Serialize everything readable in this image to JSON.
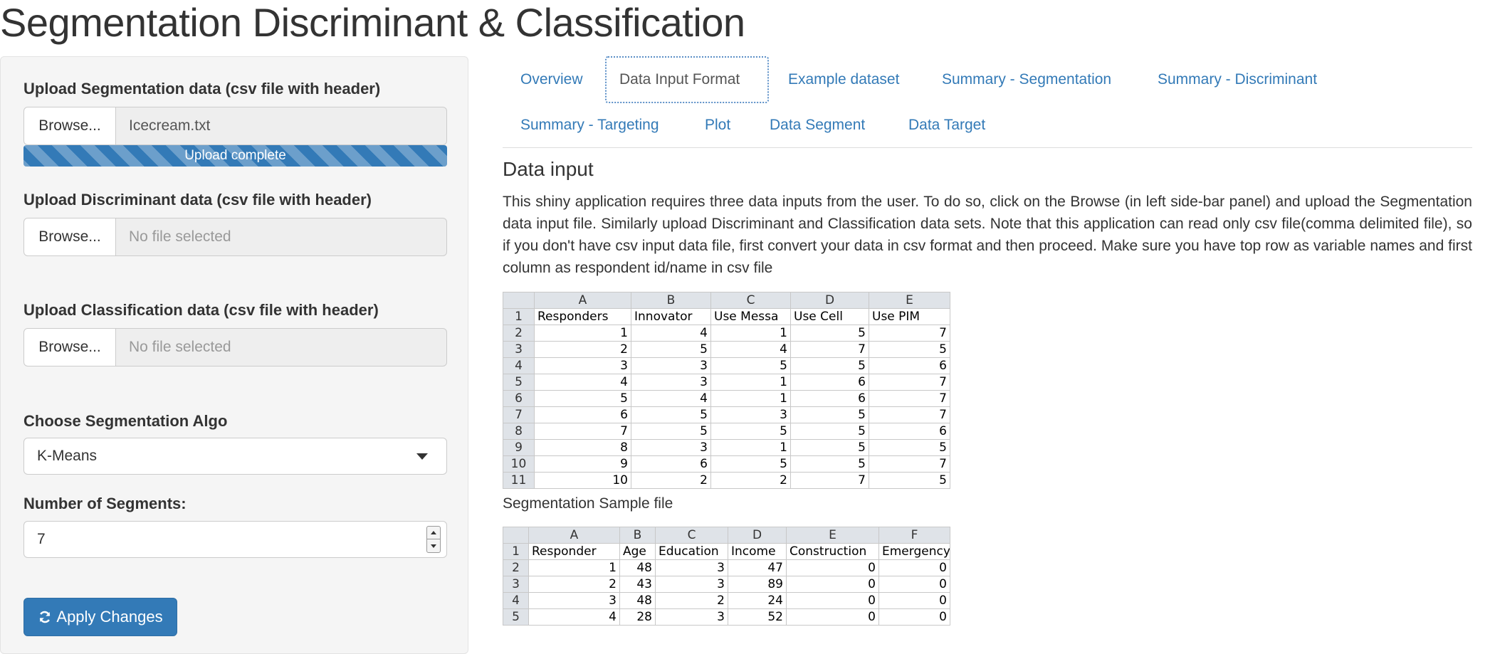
{
  "app": {
    "title": "Segmentation Discriminant & Classification"
  },
  "sidebar": {
    "segmentation_upload": {
      "label": "Upload Segmentation data (csv file with header)",
      "browse_label": "Browse...",
      "file_name": "Icecream.txt",
      "progress_text": "Upload complete",
      "progress": 1.0
    },
    "discriminant_upload": {
      "label": "Upload Discriminant data (csv file with header)",
      "browse_label": "Browse...",
      "file_name": "No file selected"
    },
    "classification_upload": {
      "label": "Upload Classification data (csv file with header)",
      "browse_label": "Browse...",
      "file_name": "No file selected"
    },
    "algo": {
      "label": "Choose Segmentation Algo",
      "selected": "K-Means"
    },
    "segments": {
      "label": "Number of Segments:",
      "value": "7"
    },
    "apply_label": "Apply Changes",
    "apply_icon": "refresh-icon"
  },
  "tabs": {
    "overview": "Overview",
    "data_input_format": "Data Input Format",
    "example_dataset": "Example dataset",
    "summary_segmentation": "Summary - Segmentation",
    "summary_discriminant": "Summary - Discriminant",
    "summary_targeting": "Summary - Targeting",
    "plot": "Plot",
    "data_segment": "Data Segment",
    "data_target": "Data Target",
    "active": "Data Input Format"
  },
  "main": {
    "heading": "Data input",
    "intro": "This shiny application requires three data inputs from the user. To do so, click on the Browse (in left side-bar panel) and upload the Segmentation data input file. Similarly upload Discriminant and Classification data sets. Note that this application can read only csv file(comma delimited file), so if you don't have csv input data file, first convert your data in csv format and then proceed. Make sure you have top row as variable names and first column as respondent id/name in csv file",
    "caption_segmentation": "Segmentation Sample file"
  },
  "sample_segmentation": {
    "col_letters": [
      "A",
      "B",
      "C",
      "D",
      "E"
    ],
    "headers": [
      "Responders",
      "Innovator",
      "Use Messa",
      "Use Cell",
      "Use PIM"
    ],
    "rows": [
      [
        1,
        4,
        1,
        5,
        7
      ],
      [
        2,
        5,
        4,
        7,
        5
      ],
      [
        3,
        3,
        5,
        5,
        6
      ],
      [
        4,
        3,
        1,
        6,
        7
      ],
      [
        5,
        4,
        1,
        6,
        7
      ],
      [
        6,
        5,
        3,
        5,
        7
      ],
      [
        7,
        5,
        5,
        5,
        6
      ],
      [
        8,
        3,
        1,
        5,
        5
      ],
      [
        9,
        6,
        5,
        5,
        7
      ],
      [
        10,
        2,
        2,
        7,
        5
      ]
    ]
  },
  "sample_discriminant": {
    "col_letters": [
      "A",
      "B",
      "C",
      "D",
      "E",
      "F"
    ],
    "headers": [
      "Responder",
      "Age",
      "Education",
      "Income",
      "Construction",
      "Emergency"
    ],
    "rows": [
      [
        1,
        48,
        3,
        47,
        0,
        0
      ],
      [
        2,
        43,
        3,
        89,
        0,
        0
      ],
      [
        3,
        48,
        2,
        24,
        0,
        0
      ],
      [
        4,
        28,
        3,
        52,
        0,
        0
      ]
    ]
  }
}
